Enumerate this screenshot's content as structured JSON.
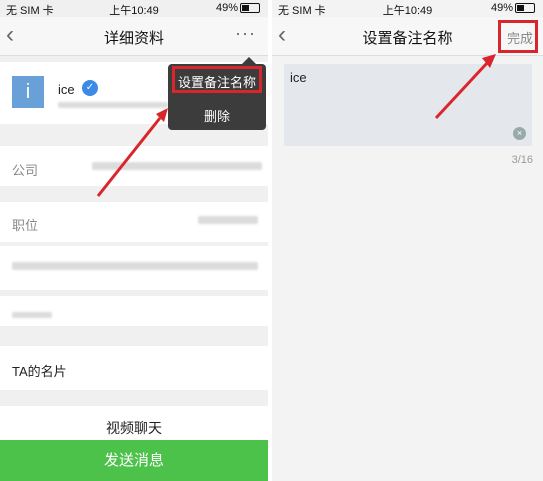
{
  "left": {
    "status": {
      "carrier": "无 SIM 卡",
      "time": "上午10:49",
      "battery": "49%",
      "battery_fraction": 0.49
    },
    "nav": {
      "title": "详细资料",
      "more": "···"
    },
    "profile": {
      "avatar_letter": "i",
      "nickname": "ice"
    },
    "fields": {
      "company": "公司",
      "position": "职位"
    },
    "menu": {
      "set_remark": "设置备注名称",
      "delete": "删除"
    },
    "card_link": "TA的名片",
    "video_chat": "视频聊天",
    "send_message": "发送消息"
  },
  "right": {
    "status": {
      "carrier": "无 SIM 卡",
      "time": "上午10:49",
      "battery": "49%",
      "battery_fraction": 0.49
    },
    "nav": {
      "title": "设置备注名称",
      "done": "完成"
    },
    "remark": {
      "value": "ice",
      "counter": "3/16"
    }
  },
  "colors": {
    "accent_green": "#4cc24a",
    "highlight_red": "#d9262c",
    "menu_bg": "#3c3c3c"
  }
}
